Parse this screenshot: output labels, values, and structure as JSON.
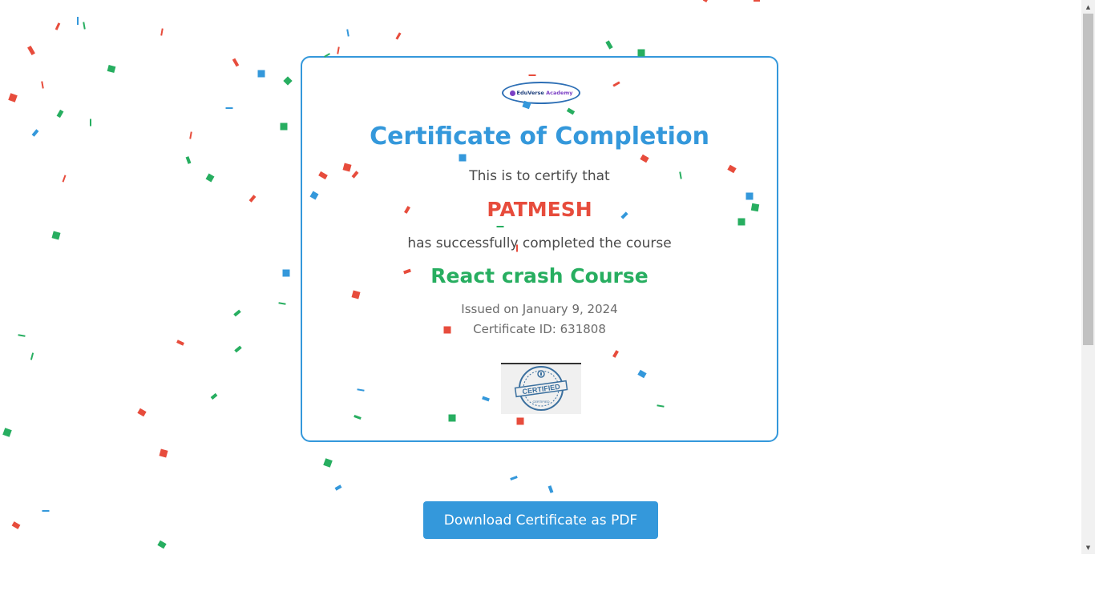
{
  "certificate": {
    "logo": {
      "name_part1": "EduVerse",
      "name_part2": "Academy",
      "icon": "academy-logo-icon"
    },
    "title": "Certificate of Completion",
    "certify_text": "This is to certify that",
    "recipient_name": "PATMESH",
    "completed_text": "has successfully completed the course",
    "course_name": "React crash Course",
    "issued_text": "Issued on January 9, 2024",
    "certificate_id_text": "Certificate ID: 631808",
    "stamp": {
      "text_main": "CERTIFIED",
      "text_sub": "CERTIFIED",
      "icon": "certified-stamp-icon"
    }
  },
  "actions": {
    "download_label": "Download Certificate as PDF"
  },
  "colors": {
    "accent_blue": "#3498db",
    "name_red": "#e74c3c",
    "course_green": "#27ae60",
    "text_gray": "#4a4a4a",
    "meta_gray": "#6b6b6b"
  },
  "decorations": {
    "confetti_colors": [
      "#e74c3c",
      "#3498db",
      "#27ae60"
    ]
  }
}
